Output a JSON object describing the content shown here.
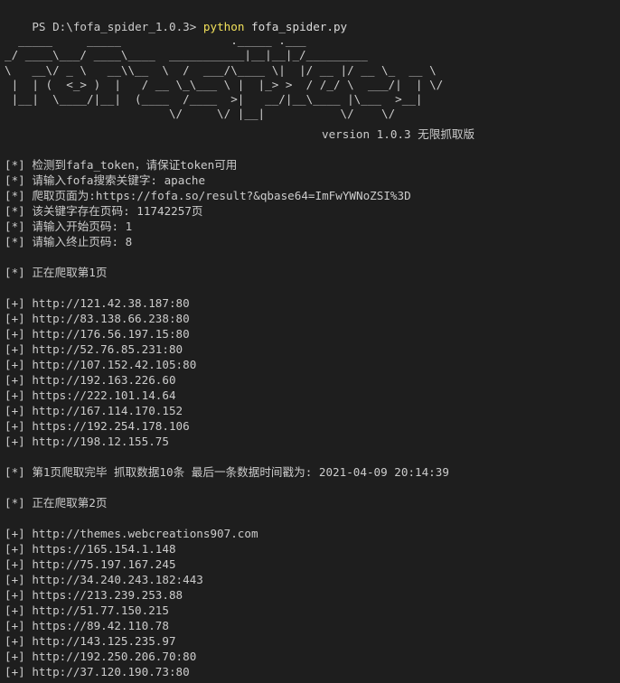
{
  "terminal": {
    "prompt": {
      "path": "PS D:\\fofa_spider_1.0.3> ",
      "command": "python",
      "argument": " fofa_spider.py"
    },
    "banner_art": "  _____     _____                ._____ .___\n_/ ____\\___/ ____\\____  ___________|__|__|_/_________\n\\   __\\/ _ \\   __\\\\__  \\  /  ___/\\____ \\|  |/ __ |/ __ \\_  __ \\\n |  | (  <_> )  |   / __ \\_\\___ \\ |  |_> >  / /_/ \\  ___/|  | \\/\n |__|  \\____/|__|  (____  /____  >|   __/|__\\____ |\\___  >__|\n                        \\/     \\/ |__|           \\/    \\/",
    "version": "version 1.0.3 无限抓取版",
    "info_lines": [
      "[*] 检测到fafa_token，请保证token可用",
      "[*] 请输入fofa搜索关键字: apache",
      "[*] 爬取页面为:https://fofa.so/result?&qbase64=ImFwYWNoZSI%3D",
      "[*] 该关键字存在页码: 11742257页",
      "[*] 请输入开始页码: 1",
      "[*] 请输入终止页码: 8"
    ],
    "page1_header": "[*] 正在爬取第1页",
    "page1_results": [
      "[+] http://121.42.38.187:80",
      "[+] http://83.138.66.238:80",
      "[+] http://176.56.197.15:80",
      "[+] http://52.76.85.231:80",
      "[+] http://107.152.42.105:80",
      "[+] http://192.163.226.60",
      "[+] https://222.101.14.64",
      "[+] http://167.114.170.152",
      "[+] https://192.254.178.106",
      "[+] http://198.12.155.75"
    ],
    "page1_done": "[*] 第1页爬取完毕 抓取数据10条 最后一条数据时间戳为: 2021-04-09 20:14:39",
    "page2_header": "[*] 正在爬取第2页",
    "page2_results": [
      "[+] http://themes.webcreations907.com",
      "[+] https://165.154.1.148",
      "[+] http://75.197.167.245",
      "[+] http://34.240.243.182:443",
      "[+] https://213.239.253.88",
      "[+] http://51.77.150.215",
      "[+] https://89.42.110.78",
      "[+] http://143.125.235.97",
      "[+] http://192.250.206.70:80",
      "[+] http://37.120.190.73:80"
    ]
  },
  "colors": {
    "background": "#1e1e1e",
    "text": "#cccccc",
    "command": "#f1e05a"
  }
}
